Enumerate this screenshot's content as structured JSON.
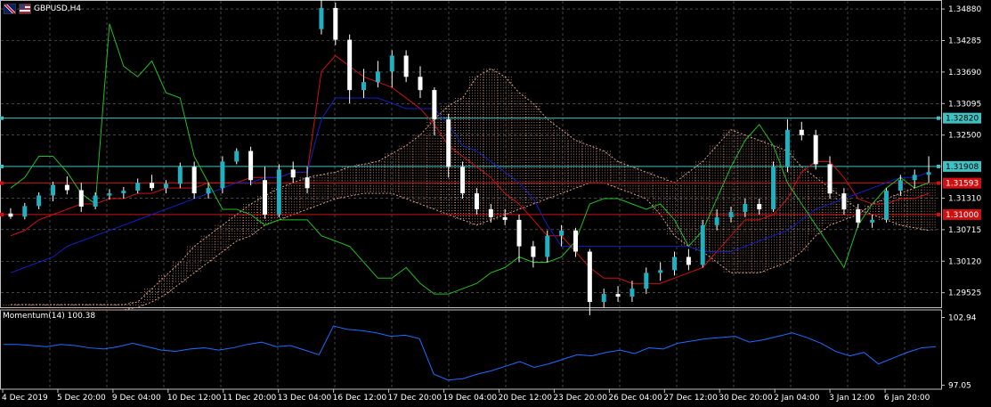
{
  "window": {
    "symbol": "GBPUSD,H4"
  },
  "main_panel": {
    "price_ticks": [
      "1.34880",
      "1.34285",
      "1.33690",
      "1.33095",
      "1.32500",
      "1.31310",
      "1.30715",
      "1.30120",
      "1.29525"
    ],
    "price_range": [
      1.2925,
      1.3505
    ],
    "price_labels": [
      {
        "text": "1.32820",
        "value": 1.3282,
        "color": "#40c0c0"
      },
      {
        "text": "1.31908",
        "value": 1.31908,
        "color": "#40c0c0"
      },
      {
        "text": "1.31593",
        "value": 1.31593,
        "color": "#d01010"
      },
      {
        "text": "1.31000",
        "value": 1.31,
        "color": "#d01010"
      }
    ]
  },
  "momentum_panel": {
    "label": "Momentum(14) 100.38",
    "ticks": [
      "102.94",
      "97.05"
    ],
    "range": [
      96.7,
      103.6
    ],
    "values": [
      100.6,
      100.6,
      100.5,
      100.4,
      100.6,
      100.5,
      100.3,
      100.2,
      100.4,
      100.7,
      100.4,
      100.1,
      100.0,
      100.2,
      100.3,
      100.1,
      100.3,
      100.6,
      100.8,
      100.4,
      100.5,
      100.1,
      99.7,
      102.2,
      101.9,
      101.8,
      101.6,
      101.3,
      101.4,
      101.1,
      98.0,
      97.5,
      97.6,
      98.0,
      98.3,
      98.7,
      99.1,
      98.6,
      98.9,
      99.3,
      99.7,
      99.6,
      99.9,
      100.1,
      99.8,
      100.3,
      100.2,
      100.7,
      100.9,
      101.1,
      101.2,
      101.3,
      100.8,
      101.0,
      101.3,
      101.6,
      101.2,
      100.7,
      100.0,
      99.6,
      99.9,
      98.9,
      99.4,
      99.9,
      100.3,
      100.4
    ],
    "line_color": "#1e6cff"
  },
  "time_axis": [
    "4 Dec 2019",
    "5 Dec 20:00",
    "9 Dec 04:00",
    "10 Dec 12:00",
    "11 Dec 20:00",
    "13 Dec 04:00",
    "16 Dec 12:00",
    "17 Dec 20:00",
    "19 Dec 04:00",
    "20 Dec 12:00",
    "23 Dec 20:00",
    "26 Dec 04:00",
    "27 Dec 12:00",
    "30 Dec 20:00",
    "2 Jan 04:00",
    "3 Jan 12:00",
    "6 Jan 20:00"
  ],
  "chart_data": {
    "type": "candlestick",
    "bull_color": "#20b0c0",
    "bear_color": "#ffffff",
    "candles": [
      [
        1.3102,
        1.3112,
        1.3092,
        1.3096
      ],
      [
        1.3096,
        1.3122,
        1.3091,
        1.3116
      ],
      [
        1.3116,
        1.3142,
        1.311,
        1.3136
      ],
      [
        1.3136,
        1.3162,
        1.3125,
        1.3156
      ],
      [
        1.3156,
        1.3172,
        1.3138,
        1.3146
      ],
      [
        1.3146,
        1.316,
        1.3105,
        1.3115
      ],
      [
        1.3115,
        1.3142,
        1.311,
        1.3136
      ],
      [
        1.3136,
        1.3148,
        1.3128,
        1.314
      ],
      [
        1.314,
        1.3152,
        1.313,
        1.3145
      ],
      [
        1.3145,
        1.3168,
        1.314,
        1.316
      ],
      [
        1.316,
        1.3175,
        1.3145,
        1.315
      ],
      [
        1.315,
        1.3165,
        1.314,
        1.3158
      ],
      [
        1.3158,
        1.3198,
        1.315,
        1.319
      ],
      [
        1.319,
        1.32,
        1.313,
        1.314
      ],
      [
        1.314,
        1.316,
        1.313,
        1.315
      ],
      [
        1.315,
        1.321,
        1.314,
        1.32
      ],
      [
        1.32,
        1.3225,
        1.3195,
        1.322
      ],
      [
        1.322,
        1.3228,
        1.3155,
        1.3165
      ],
      [
        1.3165,
        1.319,
        1.3092,
        1.31
      ],
      [
        1.31,
        1.3195,
        1.3095,
        1.3185
      ],
      [
        1.3185,
        1.32,
        1.316,
        1.317
      ],
      [
        1.317,
        1.319,
        1.314,
        1.315
      ],
      [
        1.345,
        1.351,
        1.344,
        1.349
      ],
      [
        1.349,
        1.35,
        1.342,
        1.343
      ],
      [
        1.343,
        1.344,
        1.331,
        1.3335
      ],
      [
        1.3335,
        1.3375,
        1.332,
        1.335
      ],
      [
        1.335,
        1.339,
        1.334,
        1.337
      ],
      [
        1.337,
        1.341,
        1.334,
        1.34
      ],
      [
        1.34,
        1.341,
        1.335,
        1.336
      ],
      [
        1.336,
        1.338,
        1.332,
        1.3335
      ],
      [
        1.3335,
        1.334,
        1.325,
        1.328
      ],
      [
        1.328,
        1.329,
        1.317,
        1.319
      ],
      [
        1.319,
        1.32,
        1.313,
        1.314
      ],
      [
        1.314,
        1.315,
        1.31,
        1.311
      ],
      [
        1.311,
        1.312,
        1.3085,
        1.3095
      ],
      [
        1.3095,
        1.311,
        1.308,
        1.309
      ],
      [
        1.309,
        1.31,
        1.301,
        1.304
      ],
      [
        1.304,
        1.305,
        1.3,
        1.302
      ],
      [
        1.302,
        1.307,
        1.301,
        1.306
      ],
      [
        1.306,
        1.308,
        1.304,
        1.307
      ],
      [
        1.307,
        1.3075,
        1.302,
        1.303
      ],
      [
        1.303,
        1.3035,
        1.291,
        1.2935
      ],
      [
        1.2935,
        1.296,
        1.2925,
        1.295
      ],
      [
        1.295,
        1.2965,
        1.2935,
        1.2945
      ],
      [
        1.2945,
        1.2975,
        1.2935,
        1.296
      ],
      [
        1.296,
        1.3,
        1.295,
        1.299
      ],
      [
        1.299,
        1.301,
        1.2975,
        1.2995
      ],
      [
        1.2995,
        1.303,
        1.2985,
        1.302
      ],
      [
        1.302,
        1.3035,
        1.2995,
        1.3005
      ],
      [
        1.3005,
        1.309,
        1.3,
        1.308
      ],
      [
        1.308,
        1.311,
        1.307,
        1.3095
      ],
      [
        1.3095,
        1.3115,
        1.3085,
        1.3105
      ],
      [
        1.3105,
        1.313,
        1.3095,
        1.312
      ],
      [
        1.312,
        1.313,
        1.31,
        1.311
      ],
      [
        1.311,
        1.32,
        1.3105,
        1.319
      ],
      [
        1.319,
        1.328,
        1.318,
        1.326
      ],
      [
        1.326,
        1.3275,
        1.324,
        1.325
      ],
      [
        1.325,
        1.326,
        1.3185,
        1.3195
      ],
      [
        1.3195,
        1.321,
        1.313,
        1.314
      ],
      [
        1.314,
        1.315,
        1.31,
        1.311
      ],
      [
        1.311,
        1.312,
        1.3075,
        1.3085
      ],
      [
        1.3085,
        1.31,
        1.3075,
        1.309
      ],
      [
        1.309,
        1.315,
        1.3085,
        1.3145
      ],
      [
        1.3145,
        1.3175,
        1.3135,
        1.3165
      ],
      [
        1.3165,
        1.3185,
        1.315,
        1.3175
      ],
      [
        1.3175,
        1.321,
        1.316,
        1.318
      ]
    ],
    "overlays": [
      {
        "name": "",
        "color": "#d01010",
        "values": [
          1.306,
          1.307,
          1.309,
          1.31,
          1.311,
          1.312,
          1.312,
          1.313,
          1.313,
          1.314,
          1.314,
          1.315,
          1.315,
          1.315,
          1.316,
          1.316,
          1.316,
          1.317,
          1.317,
          1.317,
          1.318,
          1.318,
          1.337,
          1.34,
          1.338,
          1.336,
          1.335,
          1.334,
          1.332,
          1.33,
          1.327,
          1.323,
          1.321,
          1.319,
          1.317,
          1.314,
          1.312,
          1.309,
          1.306,
          1.306,
          1.303,
          1.3,
          1.298,
          1.298,
          1.297,
          1.297,
          1.297,
          1.298,
          1.299,
          1.3,
          1.303,
          1.306,
          1.309,
          1.309,
          1.31,
          1.313,
          1.318,
          1.32,
          1.32,
          1.317,
          1.313,
          1.312,
          1.312,
          1.313,
          1.313,
          1.314
        ]
      },
      {
        "name": "",
        "color": "#1020c0",
        "values": [
          1.299,
          1.3,
          1.301,
          1.302,
          1.304,
          1.305,
          1.306,
          1.307,
          1.308,
          1.309,
          1.31,
          1.311,
          1.312,
          1.313,
          1.314,
          1.315,
          1.316,
          1.316,
          1.317,
          1.317,
          1.318,
          1.318,
          1.328,
          1.332,
          1.332,
          1.332,
          1.332,
          1.331,
          1.33,
          1.33,
          1.33,
          1.327,
          1.323,
          1.322,
          1.32,
          1.318,
          1.316,
          1.313,
          1.308,
          1.304,
          1.304,
          1.304,
          1.304,
          1.304,
          1.304,
          1.304,
          1.304,
          1.304,
          1.304,
          1.303,
          1.303,
          1.303,
          1.304,
          1.305,
          1.306,
          1.307,
          1.309,
          1.311,
          1.312,
          1.313,
          1.314,
          1.315,
          1.316,
          1.317,
          1.317,
          1.318
        ]
      },
      {
        "name": "",
        "color": "#20c020",
        "values": [
          1.315,
          1.317,
          1.321,
          1.321,
          1.318,
          1.314,
          1.312,
          1.346,
          1.338,
          1.336,
          1.339,
          1.333,
          1.332,
          1.321,
          1.316,
          1.311,
          1.311,
          1.31,
          1.308,
          1.309,
          1.309,
          1.309,
          1.306,
          1.305,
          1.304,
          1.301,
          1.298,
          1.298,
          1.3,
          1.297,
          1.295,
          1.295,
          1.296,
          1.297,
          1.299,
          1.3,
          1.302,
          1.301,
          1.301,
          1.302,
          1.305,
          1.312,
          1.313,
          1.313,
          1.312,
          1.311,
          1.312,
          1.309,
          1.304,
          1.307,
          1.313,
          1.319,
          1.324,
          1.327,
          1.323,
          1.316,
          1.312,
          1.308,
          1.304,
          1.3,
          1.308,
          1.312,
          1.315,
          1.317,
          1.315,
          1.316
        ]
      }
    ],
    "cloud_color": "#e0a080",
    "cloud_upper": [
      1.293,
      1.293,
      1.293,
      1.293,
      1.293,
      1.293,
      1.293,
      1.293,
      1.293,
      1.2935,
      1.296,
      1.2985,
      1.301,
      1.304,
      1.306,
      1.308,
      1.31,
      1.312,
      1.3135,
      1.315,
      1.316,
      1.317,
      1.3175,
      1.318,
      1.319,
      1.3195,
      1.32,
      1.3215,
      1.323,
      1.325,
      1.328,
      1.3305,
      1.332,
      1.336,
      1.3375,
      1.336,
      1.333,
      1.331,
      1.328,
      1.326,
      1.324,
      1.323,
      1.322,
      1.32,
      1.319,
      1.318,
      1.317,
      1.316,
      1.318,
      1.32,
      1.323,
      1.326,
      1.325,
      1.324,
      1.323,
      1.322,
      1.319,
      1.317,
      1.315,
      1.313,
      1.311,
      1.31,
      1.309,
      1.308,
      1.3075,
      1.307
    ],
    "cloud_lower": [
      1.292,
      1.292,
      1.292,
      1.292,
      1.292,
      1.292,
      1.292,
      1.292,
      1.292,
      1.2925,
      1.2935,
      1.295,
      1.297,
      1.299,
      1.301,
      1.303,
      1.305,
      1.306,
      1.308,
      1.309,
      1.31,
      1.311,
      1.312,
      1.313,
      1.3135,
      1.314,
      1.314,
      1.314,
      1.313,
      1.312,
      1.311,
      1.31,
      1.309,
      1.308,
      1.309,
      1.31,
      1.311,
      1.312,
      1.313,
      1.314,
      1.315,
      1.316,
      1.316,
      1.315,
      1.314,
      1.313,
      1.31,
      1.306,
      1.304,
      1.303,
      1.301,
      1.299,
      1.299,
      1.299,
      1.3,
      1.301,
      1.303,
      1.306,
      1.308,
      1.309,
      1.31,
      1.312,
      1.313,
      1.314,
      1.315,
      1.316
    ]
  }
}
